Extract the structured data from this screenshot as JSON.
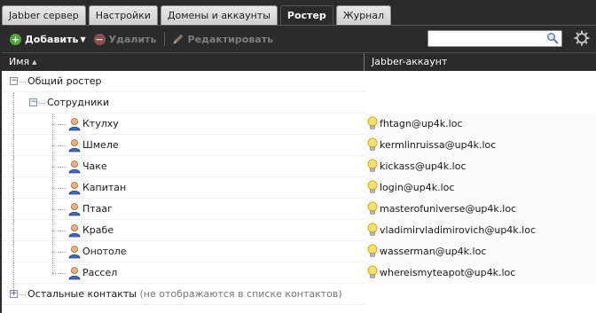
{
  "tabs": [
    {
      "label": "Jabber сервер",
      "active": false
    },
    {
      "label": "Настройки",
      "active": false
    },
    {
      "label": "Домены и аккаунты",
      "active": false
    },
    {
      "label": "Ростер",
      "active": true
    },
    {
      "label": "Журнал",
      "active": false
    }
  ],
  "toolbar": {
    "add_label": "Добавить",
    "delete_label": "Удалить",
    "edit_label": "Редактировать",
    "search_value": "",
    "search_placeholder": ""
  },
  "columns": {
    "name": "Имя",
    "jid": "Jabber-аккаунт"
  },
  "groups": {
    "common": "Общий ростер",
    "staff": "Сотрудники",
    "other": "Остальные контакты",
    "other_note": "(не отображаются в списке контактов)"
  },
  "contacts": [
    {
      "name": "Ктулху",
      "jid": "fhtagn@up4k.loc"
    },
    {
      "name": "Шмеле",
      "jid": "kermlinruissa@up4k.loc"
    },
    {
      "name": "Чаке",
      "jid": "kickass@up4k.loc"
    },
    {
      "name": "Капитан",
      "jid": "login@up4k.loc"
    },
    {
      "name": "Птааг",
      "jid": "masterofuniverse@up4k.loc"
    },
    {
      "name": "Крабе",
      "jid": "vladimirvladimirovich@up4k.loc"
    },
    {
      "name": "Онотоле",
      "jid": "wasserman@up4k.loc"
    },
    {
      "name": "Рассел",
      "jid": "whereismyteapot@up4k.loc"
    }
  ],
  "colors": {
    "dark_bg": "#2b2b2b",
    "add_green": "#4fa734",
    "tree_line": "#aaaaaa"
  },
  "icons": {
    "add": "plus-circle-icon",
    "delete": "minus-circle-icon",
    "edit": "pencil-icon",
    "search": "magnifier-icon",
    "settings": "gear-icon",
    "contact": "user-icon",
    "presence": "lightbulb-icon"
  }
}
